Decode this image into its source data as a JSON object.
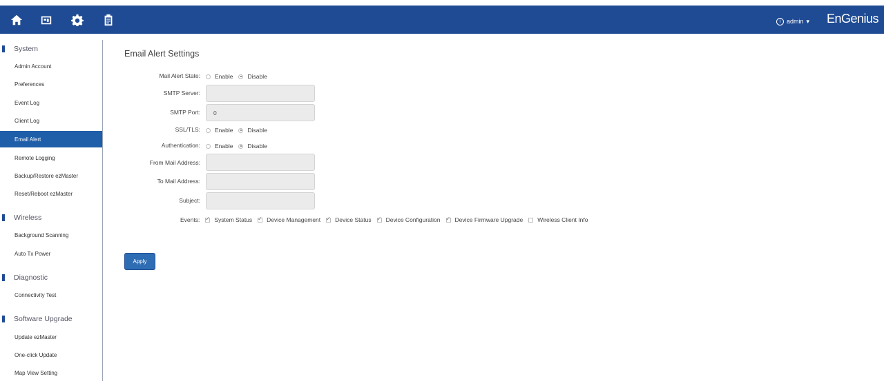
{
  "header": {
    "icons": [
      "home-icon",
      "dashboard-icon",
      "gear-icon",
      "clipboard-icon"
    ],
    "user": "admin",
    "logo": "EnGenius"
  },
  "sidebar": {
    "sections": [
      {
        "title": "System",
        "items": [
          "Admin Account",
          "Preferences",
          "Event Log",
          "Client Log",
          "Email Alert",
          "Remote Logging",
          "Backup/Restore ezMaster",
          "Reset/Reboot ezMaster"
        ]
      },
      {
        "title": "Wireless",
        "items": [
          "Background Scanning",
          "Auto Tx Power"
        ]
      },
      {
        "title": "Diagnostic",
        "items": [
          "Connectivity Test"
        ]
      },
      {
        "title": "Software Upgrade",
        "items": [
          "Update ezMaster",
          "One-click Update",
          "Map View Setting"
        ]
      }
    ],
    "active_item": "Email Alert"
  },
  "main": {
    "title": "Email Alert Settings",
    "mail_alert_state": {
      "label": "Mail Alert State:",
      "options": [
        "Enable",
        "Disable"
      ],
      "selected": "Disable"
    },
    "smtp_server": {
      "label": "SMTP Server:",
      "value": ""
    },
    "smtp_port": {
      "label": "SMTP Port:",
      "value": "0"
    },
    "ssl_tls": {
      "label": "SSL/TLS:",
      "options": [
        "Enable",
        "Disable"
      ],
      "selected": "Disable"
    },
    "authentication": {
      "label": "Authentication:",
      "options": [
        "Enable",
        "Disable"
      ],
      "selected": "Disable"
    },
    "from_mail": {
      "label": "From Mail Address:",
      "value": ""
    },
    "to_mail": {
      "label": "To Mail Address:",
      "value": ""
    },
    "subject": {
      "label": "Subject:",
      "value": ""
    },
    "events": {
      "label": "Events:",
      "items": [
        {
          "name": "System Status",
          "checked": true
        },
        {
          "name": "Device Management",
          "checked": true
        },
        {
          "name": "Device Status",
          "checked": true
        },
        {
          "name": "Device Configuration",
          "checked": true
        },
        {
          "name": "Device Firmware Upgrade",
          "checked": true
        },
        {
          "name": "Wireless Client Info",
          "checked": false
        }
      ]
    },
    "apply_label": "Apply"
  },
  "colors": {
    "header": "#1f4b94",
    "active": "#1f5ea8",
    "button": "#2e6db4"
  }
}
